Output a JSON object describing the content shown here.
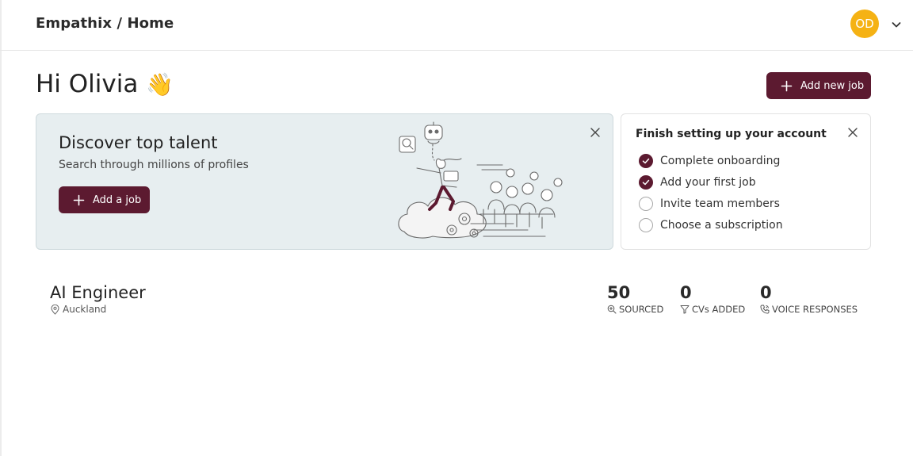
{
  "header": {
    "breadcrumb": "Empathix / Home",
    "avatar_initials": "OD",
    "avatar_color": "#f5b214"
  },
  "greeting": {
    "text": "Hi Olivia",
    "emoji": "👋"
  },
  "actions": {
    "add_new_job_label": "Add new job"
  },
  "talent_banner": {
    "title": "Discover top talent",
    "subtitle": "Search through millions of profiles",
    "button_label": "Add a job",
    "background": "#e7eef0"
  },
  "setup": {
    "title": "Finish setting up your account",
    "items": [
      {
        "label": "Complete onboarding",
        "done": true
      },
      {
        "label": "Add your first job",
        "done": true
      },
      {
        "label": "Invite team members",
        "done": false
      },
      {
        "label": "Choose a subscription",
        "done": false
      }
    ]
  },
  "job": {
    "title": "AI Engineer",
    "location": "Auckland",
    "stats": [
      {
        "value": "50",
        "label": "SOURCED",
        "icon": "search-zoom-icon"
      },
      {
        "value": "0",
        "label": "CVs ADDED",
        "icon": "filter-icon"
      },
      {
        "value": "0",
        "label": "VOICE RESPONSES",
        "icon": "phone-icon"
      }
    ]
  },
  "colors": {
    "brand": "#5c1a30",
    "accent_avatar": "#f5b214"
  }
}
